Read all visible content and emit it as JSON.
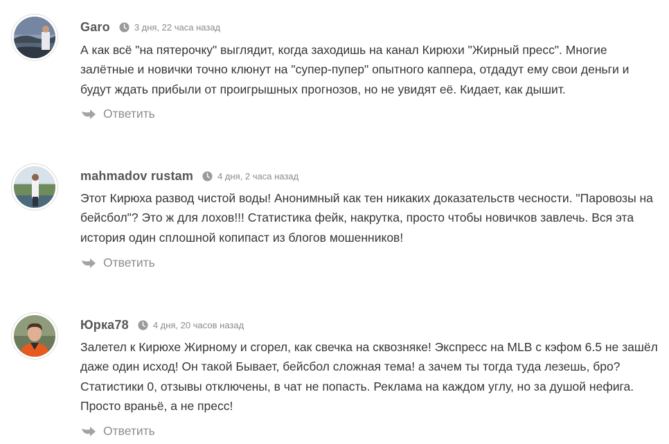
{
  "comments": [
    {
      "author": "Garo",
      "time": "3 дня, 22 часа назад",
      "text": "А как всё \"на пятерочку\" выглядит, когда заходишь на канал Кирюхи \"Жирный пресс\". Многие залётные и новички точно клюнут на \"супер-пупер\" опытного каппера, отдадут ему свои деньги и будут ждать прибыли от проигрышных прогнозов, но не увидят её. Кидает, как дышит.",
      "reply_label": "Ответить"
    },
    {
      "author": "mahmadov rustam",
      "time": "4 дня, 2 часа назад",
      "text": "Этот Кирюха развод чистой воды! Анонимный как тен никаких доказательств чесности. \"Паровозы на бейсбол\"? Это ж для лохов!!! Статистика фейк, накрутка, просто чтобы новичков завлечь. Вся эта история один сплошной копипаст из блогов мошенников!",
      "reply_label": "Ответить"
    },
    {
      "author": "Юрка78",
      "time": "4 дня, 20 часов назад",
      "text": "Залетел к Кирюхе Жирному и сгорел, как свечка на сквозняке! Экспресс на MLB с кэфом 6.5 не зашёл даже один исход! Он такой Бывает, бейсбол сложная тема! а зачем ты тогда туда лезешь, бро? Статистики 0, отзывы отключены, в чат не попасть. Реклама на каждом углу, но за душой нефига. Просто враньё, а не пресс!",
      "reply_label": "Ответить"
    }
  ]
}
